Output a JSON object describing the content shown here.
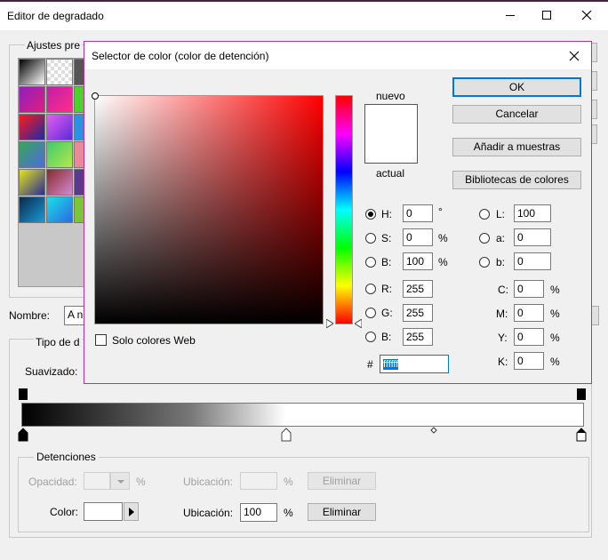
{
  "gradient_editor": {
    "title": "Editor de degradado",
    "presets_legend": "Ajustes pre",
    "name_label": "Nombre:",
    "name_value": "A n",
    "type_legend": "Tipo de d",
    "smooth_label": "Suavizado:",
    "stops_legend": "Detenciones",
    "opacity_label": "Opacidad:",
    "opacity_unit": "%",
    "opacity_location_label": "Ubicación:",
    "opacity_location_unit": "%",
    "opacity_delete": "Eliminar",
    "color_label": "Color:",
    "color_location_label": "Ubicación:",
    "color_location_value": "100",
    "color_location_unit": "%",
    "color_delete": "Eliminar"
  },
  "color_picker": {
    "title": "Selector de color (color de detención)",
    "new_label": "nuevo",
    "current_label": "actual",
    "ok": "OK",
    "cancel": "Cancelar",
    "add_swatches": "Añadir a muestras",
    "color_libraries": "Bibliotecas de colores",
    "web_only": "Solo colores Web",
    "fields": {
      "H": {
        "label": "H:",
        "value": "0",
        "unit": "°"
      },
      "S": {
        "label": "S:",
        "value": "0",
        "unit": "%"
      },
      "B": {
        "label": "B:",
        "value": "100",
        "unit": "%"
      },
      "R": {
        "label": "R:",
        "value": "255"
      },
      "G": {
        "label": "G:",
        "value": "255"
      },
      "Bl": {
        "label": "B:",
        "value": "255"
      },
      "L": {
        "label": "L:",
        "value": "100"
      },
      "a": {
        "label": "a:",
        "value": "0"
      },
      "b": {
        "label": "b:",
        "value": "0"
      },
      "C": {
        "label": "C:",
        "value": "0",
        "unit": "%"
      },
      "M": {
        "label": "M:",
        "value": "0",
        "unit": "%"
      },
      "Y": {
        "label": "Y:",
        "value": "0",
        "unit": "%"
      },
      "K": {
        "label": "K:",
        "value": "0",
        "unit": "%"
      }
    },
    "hex_label": "#",
    "hex_value": "ffffff",
    "colors": {
      "dialog_border": "#c2308c",
      "selected_hue": "#ff0000"
    }
  }
}
